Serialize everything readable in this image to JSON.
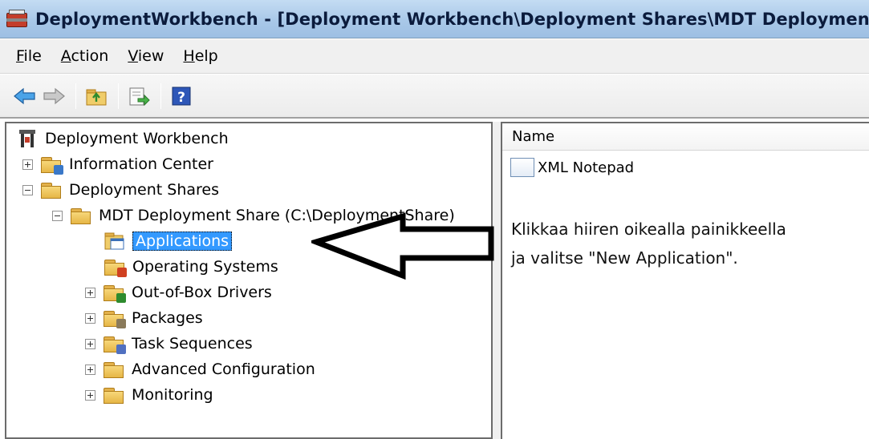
{
  "window": {
    "title": "DeploymentWorkbench - [Deployment Workbench\\Deployment Shares\\MDT Deployment Share (C:\\DeploymentShare)\\Applications]"
  },
  "menu": {
    "items": [
      {
        "label": "File",
        "accel": "F",
        "rest": "ile"
      },
      {
        "label": "Action",
        "accel": "A",
        "rest": "ction"
      },
      {
        "label": "View",
        "accel": "V",
        "rest": "iew"
      },
      {
        "label": "Help",
        "accel": "H",
        "rest": "elp"
      }
    ]
  },
  "toolbar": {
    "icons": [
      "back-arrow-icon",
      "forward-arrow-icon",
      "up-folder-icon",
      "export-list-icon",
      "help-icon"
    ]
  },
  "tree": {
    "root": "Deployment Workbench",
    "information_center": "Information Center",
    "deployment_shares": "Deployment Shares",
    "share": "MDT Deployment Share (C:\\DeploymentShare)",
    "children": [
      "Applications",
      "Operating Systems",
      "Out-of-Box Drivers",
      "Packages",
      "Task Sequences",
      "Advanced Configuration",
      "Monitoring"
    ],
    "selected": "Applications"
  },
  "list": {
    "column_header": "Name",
    "rows": [
      "XML Notepad"
    ]
  },
  "annotation": {
    "line1": "Klikkaa hiiren oikealla painikkeella",
    "line2": "ja valitse \"New Application\"."
  },
  "colors": {
    "selection": "#3399ff",
    "title_bar": "#a9c8e8",
    "arrow_stroke": "#000000"
  }
}
